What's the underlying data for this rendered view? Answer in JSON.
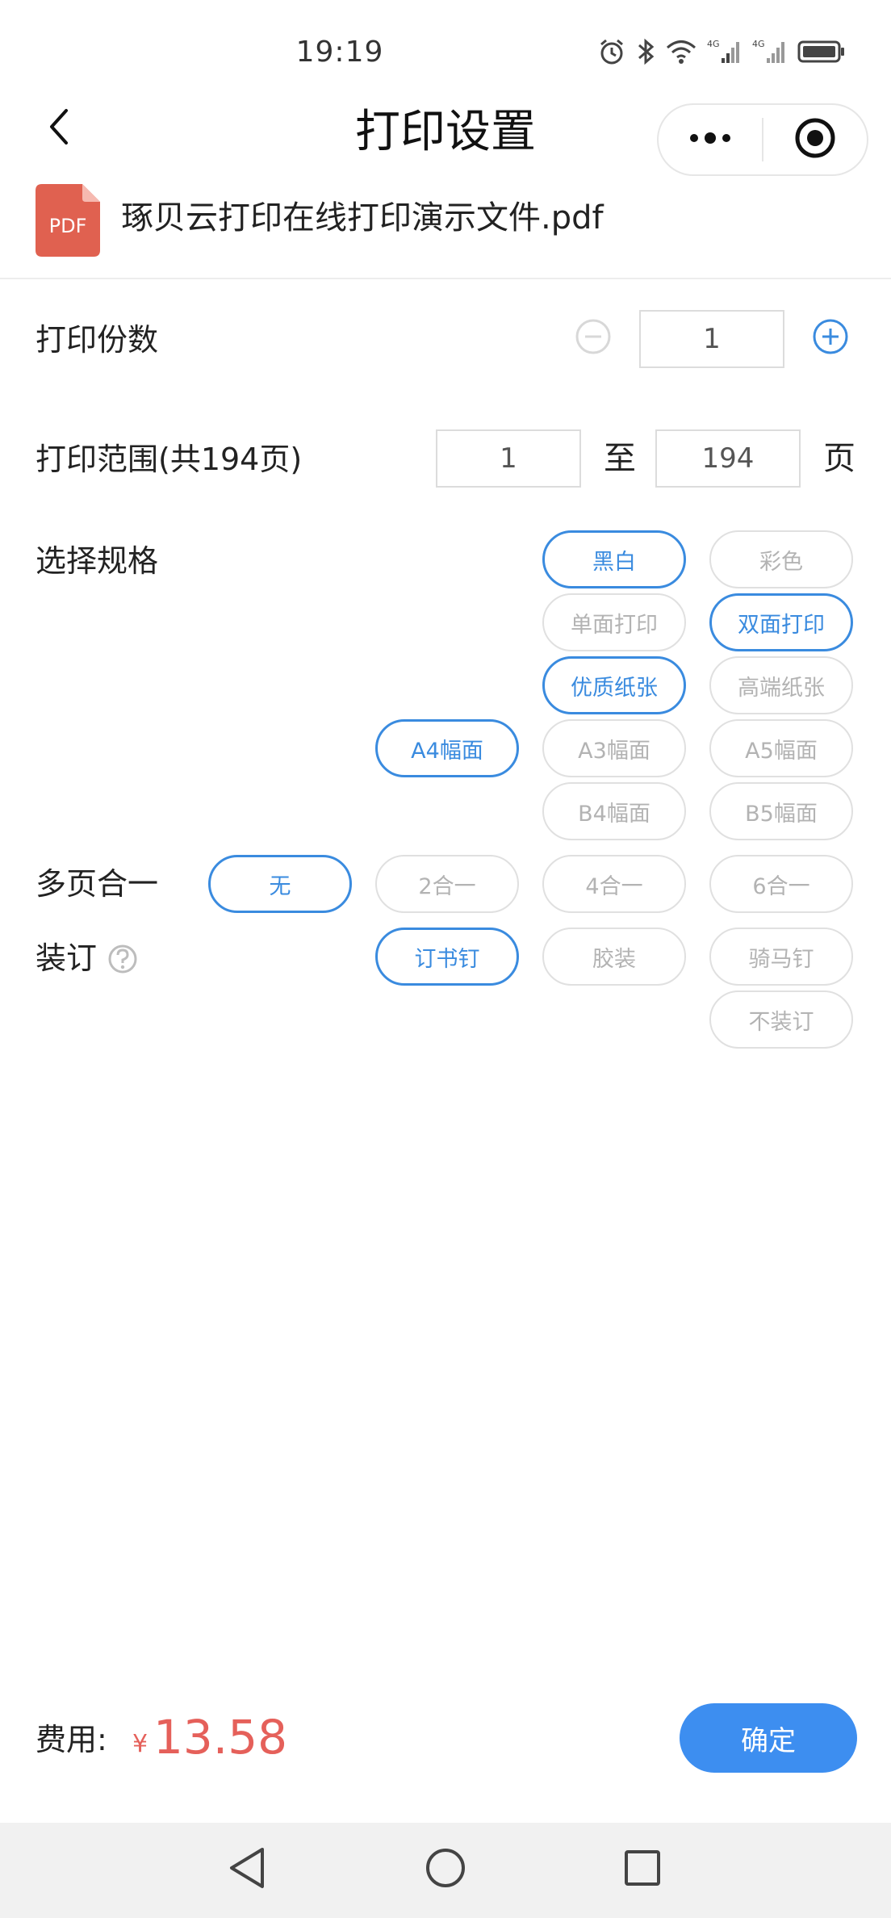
{
  "status_bar": {
    "time": "19:19",
    "icons": [
      "alarm-icon",
      "bluetooth-icon",
      "wifi-icon",
      "signal-4g-icon",
      "signal-4g-icon",
      "battery-icon"
    ]
  },
  "nav": {
    "title": "打印设置",
    "back_icon": "chevron-left-icon",
    "more_icon": "more-dots-icon",
    "close_icon": "target-circle-icon"
  },
  "file": {
    "icon_label": "PDF",
    "name": "琢贝云打印在线打印演示文件.pdf",
    "icon_color": "#e06150"
  },
  "copies": {
    "label": "打印份数",
    "value": "1"
  },
  "range": {
    "label": "打印范围(共194页)",
    "from": "1",
    "to_label": "至",
    "to": "194",
    "unit": "页"
  },
  "spec": {
    "label": "选择规格",
    "color_options": [
      {
        "label": "黑白",
        "selected": true
      },
      {
        "label": "彩色",
        "selected": false
      }
    ],
    "side_options": [
      {
        "label": "单面打印",
        "selected": false
      },
      {
        "label": "双面打印",
        "selected": true
      }
    ],
    "paper_options": [
      {
        "label": "优质纸张",
        "selected": true
      },
      {
        "label": "高端纸张",
        "selected": false
      }
    ],
    "size_options": [
      {
        "label": "A4幅面",
        "selected": true
      },
      {
        "label": "A3幅面",
        "selected": false
      },
      {
        "label": "A5幅面",
        "selected": false
      },
      {
        "label": "B4幅面",
        "selected": false
      },
      {
        "label": "B5幅面",
        "selected": false
      }
    ]
  },
  "multipage": {
    "label": "多页合一",
    "options": [
      {
        "label": "无",
        "selected": true
      },
      {
        "label": "2合一",
        "selected": false
      },
      {
        "label": "4合一",
        "selected": false
      },
      {
        "label": "6合一",
        "selected": false
      }
    ]
  },
  "binding": {
    "label": "装订",
    "help_icon": "question-circle-icon",
    "options": [
      {
        "label": "订书钉",
        "selected": true
      },
      {
        "label": "胶装",
        "selected": false
      },
      {
        "label": "骑马钉",
        "selected": false
      },
      {
        "label": "不装订",
        "selected": false
      }
    ]
  },
  "footer": {
    "fee_label": "费用:",
    "currency": "¥",
    "amount": "13.58",
    "confirm": "确定"
  },
  "colors": {
    "accent": "#3a8bdf",
    "confirm_bg": "#3d8ef0",
    "price": "#e5605a",
    "unselected_text": "#b3b3b3"
  }
}
